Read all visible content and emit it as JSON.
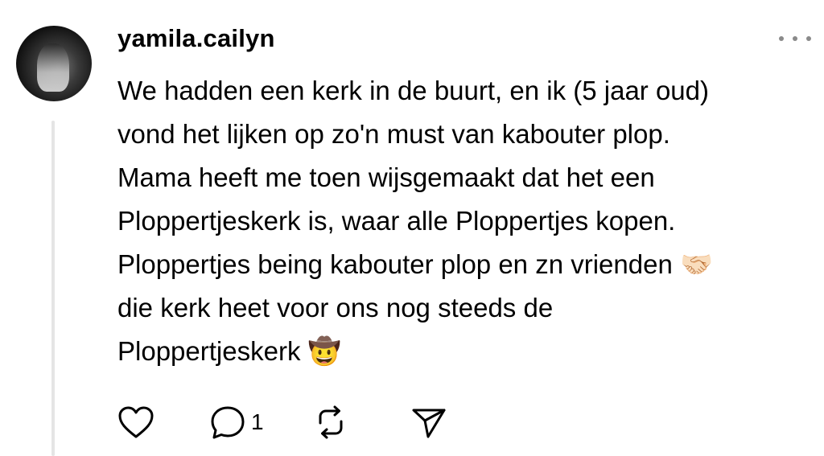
{
  "post": {
    "username": "yamila.cailyn",
    "text_lines": [
      "We hadden een kerk in de buurt, en ik (5 jaar oud)",
      "vond het lijken op zo'n must van kabouter plop.",
      "Mama heeft me toen wijsgemaakt dat het een",
      "Ploppertjeskerk is, waar alle Ploppertjes kopen.",
      "Ploppertjes being kabouter plop en zn vrienden 🤝🏻",
      "die kerk heet voor ons nog steeds de",
      "Ploppertjeskerk 🤠"
    ],
    "reply_count": "1"
  },
  "icons": {
    "like": "heart-icon",
    "reply": "speech-bubble-icon",
    "repost": "repost-arrows-icon",
    "share": "paper-plane-icon",
    "more": "ellipsis-icon"
  },
  "colors": {
    "text": "#000000",
    "muted": "#8a8a8a",
    "thread_line": "#e5e5e5",
    "background": "#ffffff"
  }
}
